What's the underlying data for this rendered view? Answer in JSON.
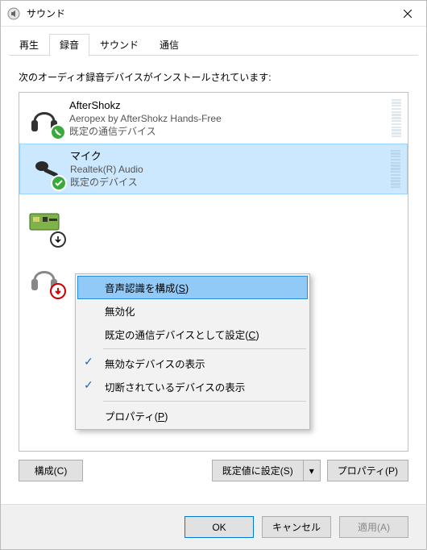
{
  "window": {
    "title": "サウンド"
  },
  "tabs": [
    {
      "label": "再生",
      "active": false
    },
    {
      "label": "録音",
      "active": true
    },
    {
      "label": "サウンド",
      "active": false
    },
    {
      "label": "通信",
      "active": false
    }
  ],
  "instruction": "次のオーディオ録音デバイスがインストールされています:",
  "devices": [
    {
      "name": "AfterShokz",
      "desc": "Aeropex by AfterShokz Hands-Free",
      "status": "既定の通信デバイス",
      "selected": false
    },
    {
      "name": "マイク",
      "desc": "Realtek(R) Audio",
      "status": "既定のデバイス",
      "selected": true
    },
    {
      "name": "",
      "desc": "",
      "status": "",
      "selected": false,
      "hidden_behind_menu": true
    },
    {
      "name": "",
      "desc": "",
      "status": "",
      "selected": false,
      "hidden_behind_menu": true
    }
  ],
  "context_menu": [
    {
      "pre": "音声認識を構成(",
      "acc": "S",
      "post": ")",
      "highlighted": true
    },
    {
      "label": "無効化"
    },
    {
      "pre": "既定の通信デバイスとして設定(",
      "acc": "C",
      "post": ")"
    },
    {
      "label": "無効なデバイスの表示",
      "checked": true
    },
    {
      "label": "切断されているデバイスの表示",
      "checked": true
    },
    {
      "pre": "プロパティ(",
      "acc": "P",
      "post": ")"
    }
  ],
  "buttons": {
    "configure": "構成(C)",
    "set_default": "既定値に設定(S)",
    "properties": "プロパティ(P)",
    "ok": "OK",
    "cancel": "キャンセル",
    "apply": "適用(A)"
  }
}
